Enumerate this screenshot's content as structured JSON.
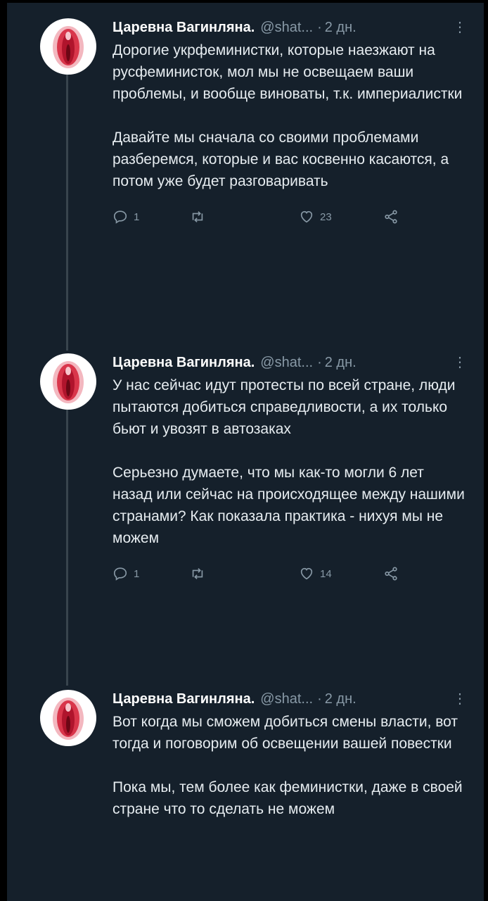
{
  "colors": {
    "background": "#15202b",
    "text": "#e6ecf0",
    "muted": "#8899a6",
    "thread_line": "#38444d"
  },
  "tweets": [
    {
      "author_name": "Царевна Вагинляна.",
      "handle": "@shat...",
      "separator": "·",
      "time": "2 дн.",
      "more_icon": "more-vertical-icon",
      "paragraphs": [
        "Дорогие укрфеминистки, которые наезжают на русфеминисток, мол мы не освещаем ваши проблемы, и вообще виноваты, т.к. империалистки",
        "Давайте мы сначала со своими проблемами разберемся, которые и вас косвенно касаются, а потом уже будет разговаривать"
      ],
      "reply_count": "1",
      "retweet_count": "",
      "like_count": "23"
    },
    {
      "author_name": "Царевна Вагинляна.",
      "handle": "@shat...",
      "separator": "·",
      "time": "2 дн.",
      "more_icon": "more-vertical-icon",
      "paragraphs": [
        "У нас сейчас идут протесты по всей стране, люди пытаются добиться справедливости, а их только бьют и увозят в автозаках",
        "Серьезно думаете, что мы как-то могли 6 лет назад или сейчас на происходящее между нашими странами? Как показала практика - нихуя мы не можем"
      ],
      "reply_count": "1",
      "retweet_count": "",
      "like_count": "14"
    },
    {
      "author_name": "Царевна Вагинляна.",
      "handle": "@shat...",
      "separator": "·",
      "time": "2 дн.",
      "more_icon": "more-vertical-icon",
      "paragraphs": [
        "Вот когда мы сможем добиться смены власти, вот тогда и поговорим об освещении вашей повестки",
        "Пока мы, тем более как феминистки, даже в своей стране что то сделать не можем"
      ]
    }
  ]
}
